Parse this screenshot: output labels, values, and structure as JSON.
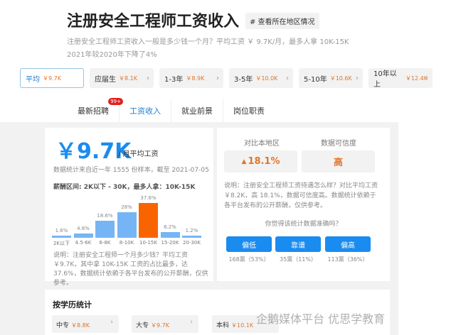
{
  "header": {
    "title": "注册安全工程师工资收入",
    "region_tag": "# 查看所在地区情况",
    "desc_line1": "注册安全工程师工资收入一般是多少钱一个月？平均工资 ￥ 9.7K/月，最多人拿 10K-15K",
    "desc_line2": "2021年较2020年下降了4%"
  },
  "chips": [
    {
      "label": "平均",
      "value": "￥9.7K"
    },
    {
      "label": "应届生",
      "value": "￥8.1K"
    },
    {
      "label": "1-3年",
      "value": "￥8.9K"
    },
    {
      "label": "3-5年",
      "value": "￥10.0K"
    },
    {
      "label": "5-10年",
      "value": "￥10.6K"
    },
    {
      "label": "10年以上",
      "value": "￥12.4K"
    }
  ],
  "tabs": [
    {
      "label": "最新招聘",
      "badge": "99+"
    },
    {
      "label": "工资收入"
    },
    {
      "label": "就业前景"
    },
    {
      "label": "岗位职责"
    }
  ],
  "salary": {
    "amount": "￥9.7K",
    "unit": "/ 月平均工资",
    "sample": "数据统计来自近一年 1555 份样本，截至 2021-07-05",
    "range": "薪酬区间: 2K以下 - 30K，最多人拿：10K-15K",
    "note": "说明：注册安全工程师一个月多少钱？平均工资 ￥9.7K，其中拿 10K-15K 工资的占比最多，达 37.6%，数据统计依赖于各平台发布的公开薪酬，仅供参考。"
  },
  "chart_data": {
    "type": "bar",
    "categories": [
      "2K以下",
      "4.5-6K",
      "6-8K",
      "8-10K",
      "10-15K",
      "15-20K",
      "20-30K"
    ],
    "values": [
      1.6,
      4.8,
      18.6,
      28,
      37.6,
      6.2,
      1.2
    ],
    "labels": [
      "1.6%",
      "4.8%",
      "18.6%",
      "28%",
      "37.6%",
      "6.2%",
      "1.2%"
    ],
    "highlight": "10-15K",
    "colors": {
      "normal": "#76b5f5",
      "highlight": "#fa6400"
    }
  },
  "compare": {
    "local_label": "对比本地区",
    "local_value": "18.1%",
    "trust_label": "数据可信度",
    "trust_value": "高",
    "note": "说明：注册安全工程师工资待遇怎么样？对比平均工资 ￥8.2K，高 18.1%，数据可信度高。数据统计依赖于各平台发布的公开薪酬，仅供参考。",
    "question": "你觉得该统计数据准确吗？",
    "votes": [
      {
        "label": "偏低",
        "count": "168票（53%）"
      },
      {
        "label": "靠谱",
        "count": "35票（11%）"
      },
      {
        "label": "偏高",
        "count": "113票（36%）"
      }
    ]
  },
  "education": {
    "title": "按学历统计",
    "items": [
      {
        "label": "中专",
        "value": "￥8.8K"
      },
      {
        "label": "大专",
        "value": "￥9.7K"
      },
      {
        "label": "本科",
        "value": "￥10.1K"
      }
    ]
  },
  "watermark": "企鹅媒体平台 优思学教育"
}
